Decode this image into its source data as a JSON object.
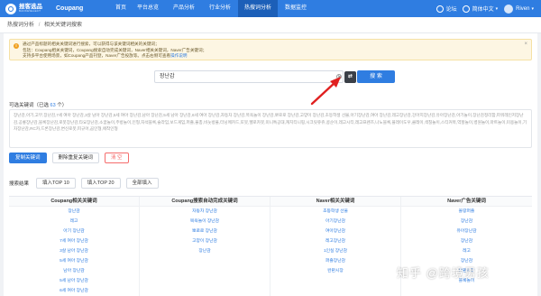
{
  "brand": {
    "name_cn": "报客选品",
    "name_en": "BAOKESELECT",
    "store": "Coupang"
  },
  "nav": {
    "items": [
      {
        "label": "首页",
        "active": false
      },
      {
        "label": "平台总览",
        "active": false
      },
      {
        "label": "产品分析",
        "active": false
      },
      {
        "label": "行业分析",
        "active": false
      },
      {
        "label": "热搜词分析",
        "active": true
      },
      {
        "label": "数据监控",
        "active": false
      }
    ],
    "right": {
      "forum": "论坛",
      "language": "简体中文",
      "user": "Riven"
    }
  },
  "breadcrumb": {
    "parent": "热搜词分析",
    "current": "相关关键词搜索"
  },
  "tip": {
    "line1": "通过产品标题的相关关键词进行搜索，可以获得与该关键词相关的关键词；",
    "line2": "包括：Coupang相关关键词，Coupang搜索自动完成关键词，Naver相关关键词，Naver广告关键词；",
    "line3": "支持多平台使用场景，如Coupang产品刊登，Naver广告投放等。点击右侧可查看",
    "link": "操作说明"
  },
  "search": {
    "value": "장난감",
    "button": "搜 索",
    "translate_icon": "translate-icon"
  },
  "keywords": {
    "title": "可选关键词",
    "count_prefix": "（已选 ",
    "count": "63",
    "count_suffix": " 个）",
    "text": "장난감,아기,고무,장난감,7세 여아 장난감,3살 남아 장난감,5세 여아 장난감,남아 장난감,5세 남아 장난감,6세 여아 장난감,자동차 장난감,목욕놀이 장난감,뽀로로 장난감,고양이 장난감,초등학생 선물,아기장난감,여아 장난감,레고장난감,강아지장난감,유아장난감,아기놀이,장난감정리함,파워레인저장난감,공룡장난감,블록장난감,로봇장난감,타요장난감,소꿉놀이,주방놀이,인형,자석블록,슬라임,보드게임,퍼즐,물총,비눗방울,터닝메카드,또봇,헬로카봇,미니특공대,캐치티니핑,시크릿쥬쥬,콩순이,레고시티,레고프렌즈,나노블록,플레이도우,클레이,색칠놀이,스티커북,역할놀이,병원놀이,마트놀이,미용놀이,기차장난감,RC카,드론장난감,변신로봇,피규어,곰인형,애착인형"
  },
  "actions": {
    "copy": "复制关键词",
    "dedupe": "删除重复关键词",
    "clear": "清 空"
  },
  "fill": {
    "label": "搜索结果",
    "top10": "填入TOP 10",
    "top20": "填入TOP 20",
    "all": "全部填入"
  },
  "columns": [
    {
      "title": "Coupang相关关键词",
      "items": [
        "장난감",
        "레고",
        "아기 장난감",
        "7세 여아 장난감",
        "3살 남아 장난감",
        "5세 여아 장난감",
        "남아 장난감",
        "5세 남아 장난감",
        "6세 여아 장난감"
      ]
    },
    {
      "title": "Coupang搜索自动完成关键词",
      "items": [
        "자동차 장난감",
        "목욕놀이 장난감",
        "뽀로로 장난감",
        "고양이 장난감",
        "장난감"
      ]
    },
    {
      "title": "Naver相关关键词",
      "items": [
        "초등학생 선물",
        "아기장난감",
        "여아장난감",
        "레고장난감",
        "1인실 장난감",
        "퍼즐장난감",
        "완판시장"
      ]
    },
    {
      "title": "Naver广告关键词",
      "items": [
        "몰랑퍼즐",
        "장난감",
        "유아장난감",
        "장난감",
        "레고",
        "장난감",
        "완판시장",
        "블록놀이"
      ]
    }
  ],
  "watermark": "知乎 @跨境男孩",
  "colors": {
    "primary": "#2f7de1",
    "danger": "#f56c6c",
    "annotation": "#e02020"
  }
}
